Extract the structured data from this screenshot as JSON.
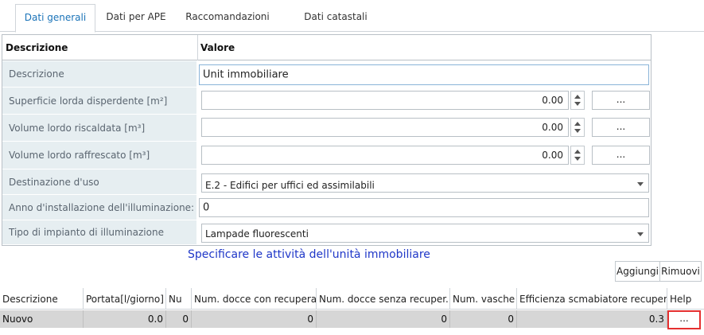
{
  "tabs": [
    {
      "label": "Dati generali",
      "active": true
    },
    {
      "label": "Dati per APE",
      "active": false
    },
    {
      "label": "Raccomandazioni",
      "active": false
    },
    {
      "label": "Dati catastali",
      "active": false
    }
  ],
  "grid": {
    "header": {
      "col1": "Descrizione",
      "col2": "Valore"
    },
    "rows": [
      {
        "label": "Descrizione",
        "value": "Unit immobiliare"
      },
      {
        "label": "Superficie lorda disperdente [m²]",
        "value": "0.00",
        "button": "..."
      },
      {
        "label": "Volume lordo riscaldata [m³]",
        "value": "0.00",
        "button": "..."
      },
      {
        "label": "Volume lordo raffrescato [m³]",
        "value": "0.00",
        "button": "..."
      },
      {
        "label": "Destinazione d'uso",
        "value": "E.2 - Edifici per uffici ed assimilabili"
      },
      {
        "label": "Anno d'installazione dell'illuminazione:",
        "value": "0"
      },
      {
        "label": "Tipo di impianto di illuminazione",
        "value": "Lampade fluorescenti"
      }
    ]
  },
  "hint": "Specificare le attività dell'unità immobiliare",
  "actions": {
    "add": "Aggiungi",
    "remove": "Rimuovi"
  },
  "table": {
    "columns": [
      "Descrizione",
      "Portata[l/giorno]",
      "Nu",
      "Num. docce con recupera...",
      "Num. docce senza recuper...",
      "Num. vasche",
      "Efficienza scmabiatore recuper...",
      "Help"
    ],
    "rows": [
      {
        "cells": [
          "Nuovo",
          "0.0",
          "0",
          "0",
          "0",
          "0",
          "0.3"
        ],
        "help": "..."
      }
    ]
  },
  "colors": {
    "accent": "#1a73b8",
    "hint": "#1f37c8",
    "highlight": "#e53030",
    "label_bg": "#e6eef1"
  }
}
